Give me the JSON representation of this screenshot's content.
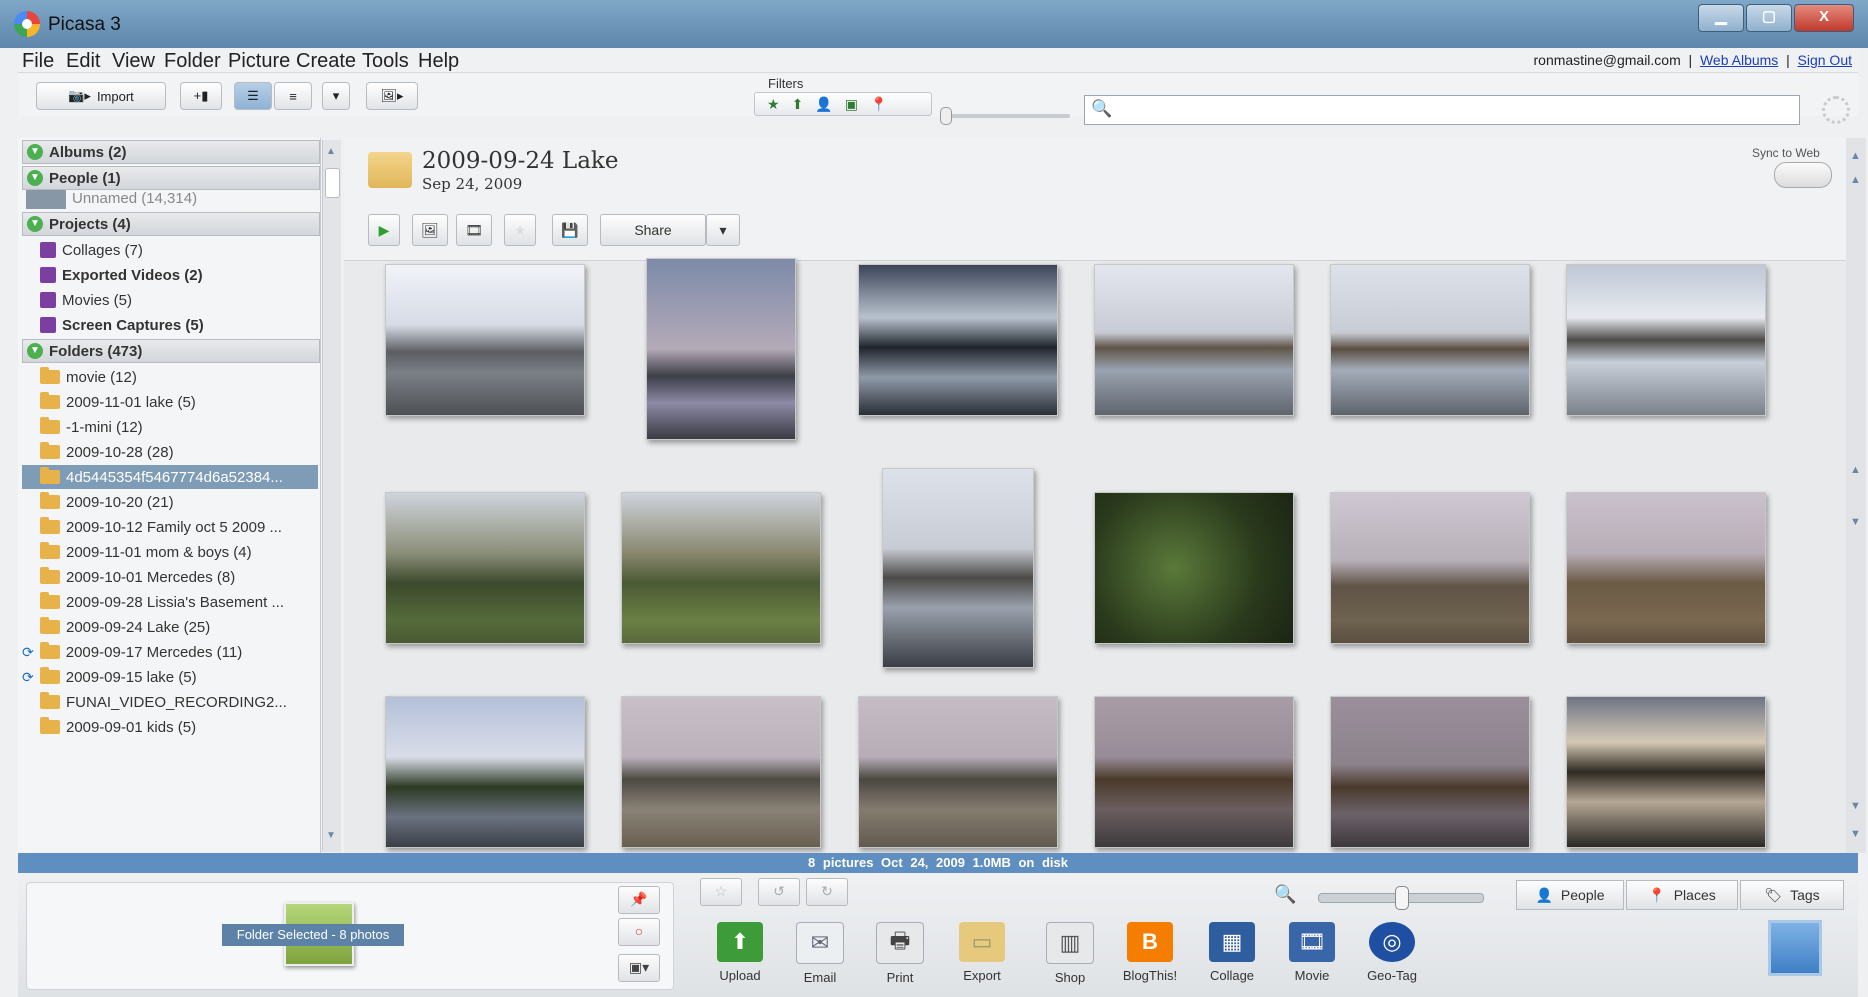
{
  "window": {
    "title": "Picasa 3",
    "min": "▁",
    "max": "▢",
    "close": "X"
  },
  "menu": [
    "File",
    "Edit",
    "View",
    "Folder",
    "Picture",
    "Create",
    "Tools",
    "Help"
  ],
  "account": {
    "email": "ronmastine@gmail.com",
    "sep": "|",
    "web_albums": "Web Albums",
    "sign_out": "Sign Out"
  },
  "toolbar": {
    "import": "Import",
    "filters_label": "Filters",
    "search_placeholder": ""
  },
  "sidebar": {
    "sections": {
      "albums": "Albums (2)",
      "people": "People (1)",
      "people_unnamed": "Unnamed (14,314)",
      "projects": "Projects (4)",
      "folders": "Folders (473)"
    },
    "projects": [
      "Collages (7)",
      "Exported Videos (2)",
      "Movies (5)",
      "Screen Captures (5)"
    ],
    "folders": [
      "movie (12)",
      "2009-11-01 lake (5)",
      "-1-mini (12)",
      "2009-10-28 (28)",
      "4d5445354f5467774d6a52384...",
      "2009-10-20 (21)",
      "2009-10-12 Family oct 5 2009 ...",
      "2009-11-01 mom & boys (4)",
      "2009-10-01 Mercedes (8)",
      "2009-09-28 Lissia's Basement ...",
      "2009-09-24 Lake (25)",
      "2009-09-17 Mercedes (11)",
      "2009-09-15 lake (5)",
      "FUNAI_VIDEO_RECORDING2...",
      "2009-09-01 kids (5)"
    ]
  },
  "album": {
    "title": "2009-09-24 Lake",
    "date": "Sep 24, 2009",
    "sync_to_web": "Sync to Web",
    "share": "Share"
  },
  "status": "8 pictures   Oct 24, 2009   1.0MB on disk",
  "tray": {
    "folder_selected": "Folder Selected - 8 photos",
    "actions": [
      "Upload",
      "Email",
      "Print",
      "Export",
      "Shop",
      "BlogThis!",
      "Collage",
      "Movie",
      "Geo-Tag"
    ],
    "tag_buttons": [
      "People",
      "Places",
      "Tags"
    ]
  }
}
